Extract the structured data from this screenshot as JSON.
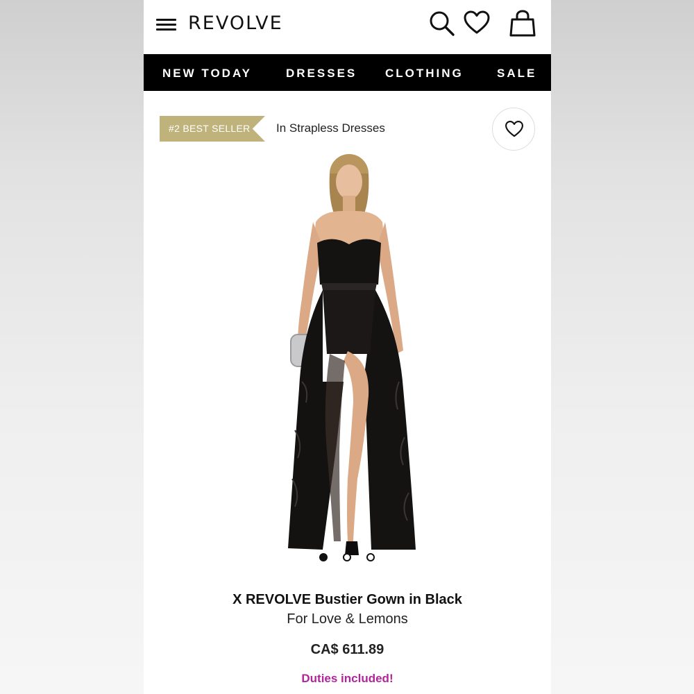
{
  "header": {
    "logo": "REVOLVE",
    "icons": [
      "menu-icon",
      "search-icon",
      "heart-icon",
      "shopping-bag-icon"
    ]
  },
  "nav": {
    "items": [
      {
        "label": "NEW TODAY"
      },
      {
        "label": "DRESSES"
      },
      {
        "label": "CLOTHING"
      },
      {
        "label": "SALE"
      }
    ]
  },
  "badge": {
    "label": "#2 BEST SELLER",
    "category": "In Strapless Dresses"
  },
  "gallery": {
    "image": "model-in-black-strapless-tulle-gown",
    "slide_count": 3,
    "active_slide": 1
  },
  "product": {
    "name": "X REVOLVE Bustier Gown in Black",
    "brand": "For Love & Lemons",
    "price": "CA$ 611.89",
    "duties_note": "Duties included!"
  },
  "colors": {
    "badge": "#bfb27a",
    "nav_bg": "#000000",
    "duties": "#b0269a"
  }
}
